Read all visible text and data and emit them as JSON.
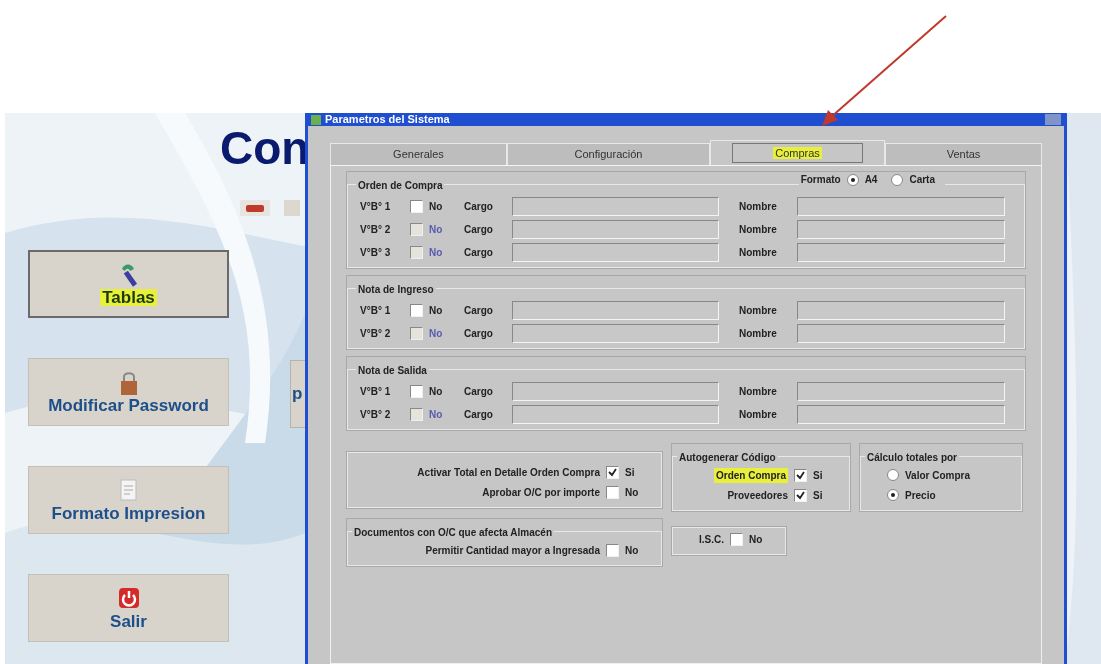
{
  "main_window": {
    "title": "Con",
    "menu_buttons": [
      {
        "label": "Tablas",
        "highlighted": true
      },
      {
        "label": "Modificar Password",
        "highlighted": false
      },
      {
        "label": "Formato Impresion",
        "highlighted": false
      },
      {
        "label": "Salir",
        "highlighted": false
      }
    ],
    "cut_button_text": "p"
  },
  "dialog": {
    "title": "Parametros del Sistema",
    "tabs": [
      {
        "label": "Generales",
        "selected": false,
        "highlighted": false
      },
      {
        "label": "Configuración",
        "selected": false,
        "highlighted": false
      },
      {
        "label": "Compras",
        "selected": true,
        "highlighted": true
      },
      {
        "label": "Ventas",
        "selected": false,
        "highlighted": false
      }
    ],
    "approval_groups": [
      {
        "title": "Orden de Compra",
        "format": {
          "label": "Formato",
          "options": [
            {
              "label": "A4",
              "selected": true
            },
            {
              "label": "Carta",
              "selected": false
            }
          ]
        },
        "rows": [
          {
            "label": "V°B° 1",
            "check_label": "No",
            "checked": false,
            "disabled": false,
            "cargo_label": "Cargo",
            "nombre_label": "Nombre"
          },
          {
            "label": "V°B° 2",
            "check_label": "No",
            "checked": false,
            "disabled": true,
            "cargo_label": "Cargo",
            "nombre_label": "Nombre"
          },
          {
            "label": "V°B° 3",
            "check_label": "No",
            "checked": false,
            "disabled": true,
            "cargo_label": "Cargo",
            "nombre_label": "Nombre"
          }
        ]
      },
      {
        "title": "Nota de Ingreso",
        "rows": [
          {
            "label": "V°B° 1",
            "check_label": "No",
            "checked": false,
            "disabled": false,
            "cargo_label": "Cargo",
            "nombre_label": "Nombre"
          },
          {
            "label": "V°B° 2",
            "check_label": "No",
            "checked": false,
            "disabled": true,
            "cargo_label": "Cargo",
            "nombre_label": "Nombre"
          }
        ]
      },
      {
        "title": "Nota de Salida",
        "rows": [
          {
            "label": "V°B° 1",
            "check_label": "No",
            "checked": false,
            "disabled": false,
            "cargo_label": "Cargo",
            "nombre_label": "Nombre"
          },
          {
            "label": "V°B° 2",
            "check_label": "No",
            "checked": false,
            "disabled": true,
            "cargo_label": "Cargo",
            "nombre_label": "Nombre"
          }
        ]
      }
    ],
    "option_groups": [
      {
        "kind": "checks",
        "options": [
          {
            "label": "Activar Total en Detalle Orden Compra",
            "check_label": "Si",
            "checked": true,
            "highlighted": false
          },
          {
            "label": "Aprobar O/C por importe",
            "check_label": "No",
            "checked": false,
            "highlighted": false
          }
        ]
      },
      {
        "kind": "checks",
        "title": "Autogenerar Código",
        "options": [
          {
            "label": "Orden Compra",
            "check_label": "Si",
            "checked": true,
            "highlighted": true
          },
          {
            "label": "Proveedores",
            "check_label": "Si",
            "checked": true,
            "highlighted": false
          }
        ]
      },
      {
        "kind": "radios",
        "title": "Cálculo totales por",
        "options": [
          {
            "label": "Valor Compra",
            "selected": false
          },
          {
            "label": "Precio",
            "selected": true
          }
        ]
      },
      {
        "kind": "checks",
        "title": "Documentos con O/C que afecta Almacén",
        "options": [
          {
            "label": "Permitir Cantidad mayor a Ingresada",
            "check_label": "No",
            "checked": false,
            "highlighted": false
          }
        ]
      },
      {
        "kind": "checks",
        "options": [
          {
            "label": "I.S.C.",
            "check_label": "No",
            "checked": false,
            "highlighted": false
          }
        ]
      }
    ]
  }
}
